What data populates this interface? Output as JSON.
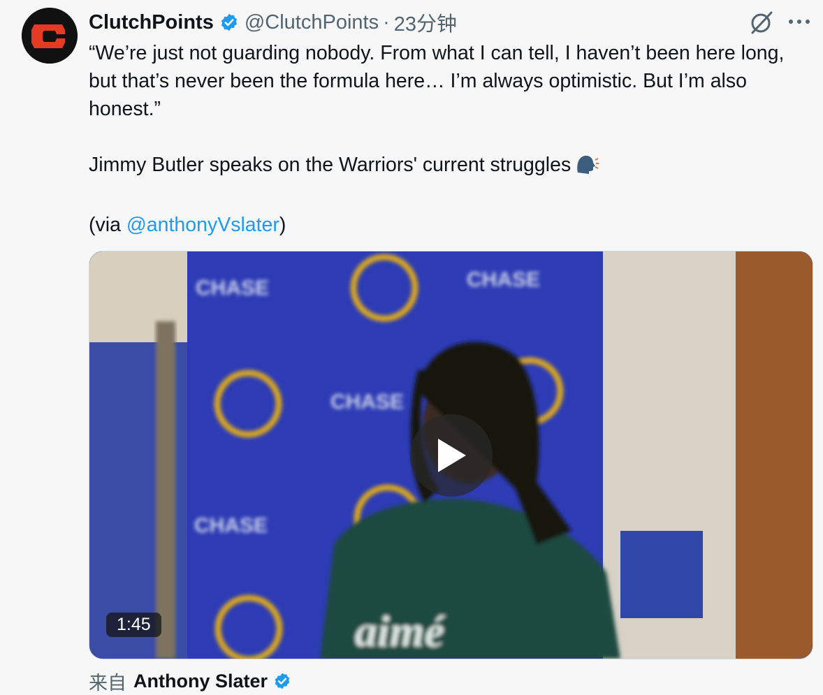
{
  "tweet": {
    "author_name": "ClutchPoints",
    "handle": "@ClutchPoints",
    "separator": "·",
    "time": "23分钟",
    "text_quote": "“We’re just not guarding nobody. From what I can tell, I haven’t been here long, but that’s never been the formula here… I’m always optimistic. But I’m also honest.”",
    "text_body": "Jimmy Butler speaks on the Warriors' current struggles",
    "via_prefix": "(via ",
    "via_mention": "@anthonyVslater",
    "via_suffix": ")",
    "emoji_icon": "speaking-head-icon"
  },
  "media": {
    "type": "video",
    "duration": "1:45",
    "play_icon": "play-icon",
    "backdrop_text": "CHASE",
    "jacket_text": "aimé"
  },
  "source": {
    "prefix": "来自",
    "author": "Anthony Slater"
  },
  "icons": {
    "verified": "verified-badge-icon",
    "grok": "grok-icon",
    "more": "more-icon"
  },
  "colors": {
    "link": "#1d9bf0",
    "verified": "#1d9bf0",
    "secondary_text": "#536471",
    "brand_red": "#e53a24"
  }
}
